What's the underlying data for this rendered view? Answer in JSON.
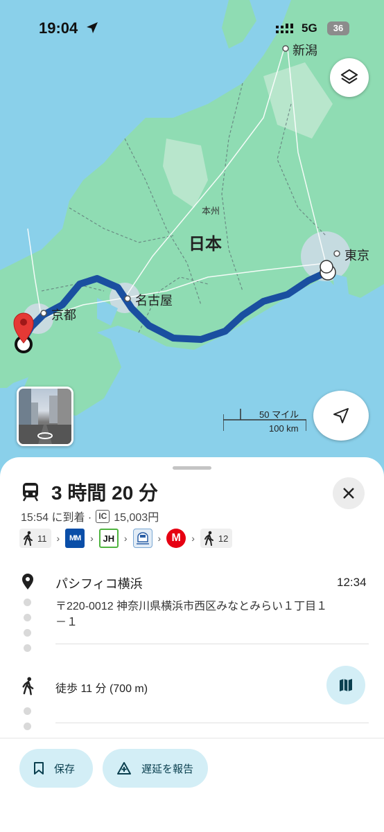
{
  "status_bar": {
    "time": "19:04",
    "network": "5G",
    "battery": "36"
  },
  "map": {
    "labels": {
      "niigata": "新潟",
      "honshu": "本州",
      "japan": "日本",
      "tokyo": "東京",
      "nagoya": "名古屋",
      "kyoto": "京都"
    },
    "scale": {
      "miles": "50 マイル",
      "km": "100 km"
    },
    "icons": {
      "layers": "layers-icon",
      "my_location": "navigation-arrow-icon",
      "street_view": "street-view-icon"
    }
  },
  "route": {
    "title": "3 時間 20 分",
    "arrival": "15:54 に到着 ·",
    "ic_label": "IC",
    "fare": "15,003円",
    "steps": [
      {
        "type": "walk",
        "minutes": "11"
      },
      {
        "type": "line",
        "label": "MM"
      },
      {
        "type": "line",
        "label": "JH"
      },
      {
        "type": "line",
        "label": "shinkansen"
      },
      {
        "type": "line",
        "label": "M"
      },
      {
        "type": "walk",
        "minutes": "12"
      }
    ],
    "destination": {
      "name": "パシフィコ横浜",
      "time": "12:34",
      "address": "〒220-0012 神奈川県横浜市西区みなとみらい１丁目１－１"
    },
    "walk_text": "徒歩 11 分 (700 m)"
  },
  "actions": {
    "save": "保存",
    "report_delay": "遅延を報告"
  },
  "colors": {
    "route": "#1a4fa0",
    "water": "#8ad0ea",
    "land": "#8fdcb3",
    "accent": "#d3eef6"
  }
}
